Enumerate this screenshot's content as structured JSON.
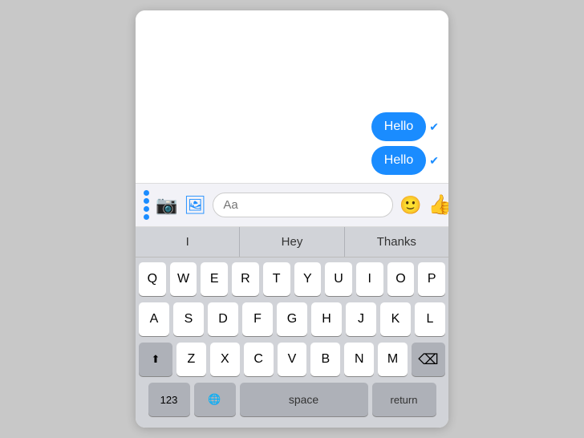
{
  "colors": {
    "bubble": "#1a8cff",
    "keyboard_bg": "#d1d3d8",
    "key_bg": "#ffffff",
    "special_key_bg": "#aeb1b8",
    "toolbar_bg": "#f2f2f7"
  },
  "chat": {
    "messages": [
      {
        "text": "Hello",
        "read": true
      },
      {
        "text": "Hello",
        "read": true
      }
    ]
  },
  "toolbar": {
    "input_placeholder": "Aa"
  },
  "autocomplete": {
    "suggestions": [
      "I",
      "Hey",
      "Thanks"
    ]
  },
  "keyboard": {
    "rows": [
      [
        "Q",
        "W",
        "E",
        "R",
        "T",
        "Y",
        "U",
        "I",
        "O",
        "P"
      ],
      [
        "A",
        "S",
        "D",
        "F",
        "G",
        "H",
        "J",
        "K",
        "L"
      ],
      [
        "⇧",
        "Z",
        "X",
        "C",
        "V",
        "B",
        "N",
        "M",
        "⌫"
      ]
    ],
    "bottom_row": [
      "123",
      "space",
      "return"
    ]
  }
}
